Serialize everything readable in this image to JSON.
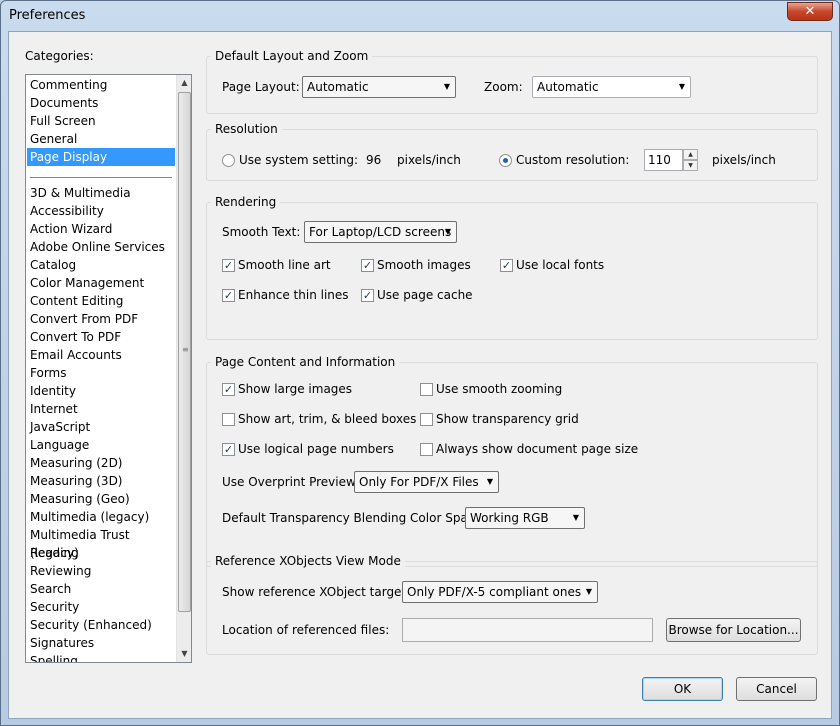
{
  "window": {
    "title": "Preferences",
    "close_glyph": "✕"
  },
  "categories": {
    "label": "Categories:",
    "primary": [
      "Commenting",
      "Documents",
      "Full Screen",
      "General",
      "Page Display"
    ],
    "selected": "Page Display",
    "secondary": [
      "3D & Multimedia",
      "Accessibility",
      "Action Wizard",
      "Adobe Online Services",
      "Catalog",
      "Color Management",
      "Content Editing",
      "Convert From PDF",
      "Convert To PDF",
      "Email Accounts",
      "Forms",
      "Identity",
      "Internet",
      "JavaScript",
      "Language",
      "Measuring (2D)",
      "Measuring (3D)",
      "Measuring (Geo)",
      "Multimedia (legacy)",
      "Multimedia Trust (legacy)",
      "Reading",
      "Reviewing",
      "Search",
      "Security",
      "Security (Enhanced)",
      "Signatures",
      "Spelling"
    ]
  },
  "layout_zoom": {
    "title": "Default Layout and Zoom",
    "page_layout_label": "Page Layout:",
    "page_layout_value": "Automatic",
    "zoom_label": "Zoom:",
    "zoom_value": "Automatic"
  },
  "resolution": {
    "title": "Resolution",
    "system_label": "Use system setting:",
    "system_value": "96",
    "system_unit": "pixels/inch",
    "custom_label": "Custom resolution:",
    "custom_value": "110",
    "custom_unit": "pixels/inch",
    "selected": "custom"
  },
  "rendering": {
    "title": "Rendering",
    "smooth_text_label": "Smooth Text:",
    "smooth_text_value": "For Laptop/LCD screens",
    "smooth_line_art": "Smooth line art",
    "smooth_images": "Smooth images",
    "use_local_fonts": "Use local fonts",
    "enhance_thin_lines": "Enhance thin lines",
    "use_page_cache": "Use page cache",
    "checked": {
      "smooth_line_art": true,
      "smooth_images": true,
      "use_local_fonts": true,
      "enhance_thin_lines": true,
      "use_page_cache": true
    }
  },
  "page_content": {
    "title": "Page Content and Information",
    "show_large_images": "Show large images",
    "use_smooth_zooming": "Use smooth zooming",
    "show_art_trim": "Show art, trim, & bleed boxes",
    "show_transparency_grid": "Show transparency grid",
    "use_logical_page_numbers": "Use logical page numbers",
    "always_show_page_size": "Always show document page size",
    "overprint_label": "Use Overprint Preview:",
    "overprint_value": "Only For PDF/X Files",
    "blending_label": "Default Transparency Blending Color Space:",
    "blending_value": "Working RGB",
    "checked": {
      "show_large_images": true,
      "use_smooth_zooming": false,
      "show_art_trim": false,
      "show_transparency_grid": false,
      "use_logical_page_numbers": true,
      "always_show_page_size": false
    }
  },
  "xobjects": {
    "title": "Reference XObjects View Mode",
    "targets_label": "Show reference XObject targets:",
    "targets_value": "Only PDF/X-5 compliant ones",
    "location_label": "Location of referenced files:",
    "location_value": "",
    "browse_label": "Browse for Location..."
  },
  "buttons": {
    "ok": "OK",
    "cancel": "Cancel"
  },
  "glyphs": {
    "check": "✓",
    "dropdown": "▼",
    "up": "▲",
    "down": "▼",
    "grip": "≡"
  }
}
